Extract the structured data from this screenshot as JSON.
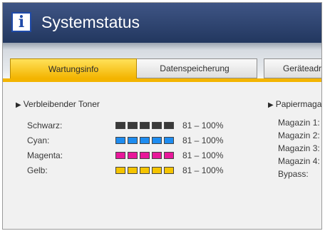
{
  "header": {
    "title": "Systemstatus",
    "icon": "info-icon"
  },
  "tabs": [
    {
      "label": "Wartungsinfo",
      "active": true
    },
    {
      "label": "Datenspeicherung",
      "active": false
    },
    {
      "label": "Geräteadr",
      "active": false
    }
  ],
  "toner": {
    "heading": "Verbleibender Toner",
    "rows": [
      {
        "label": "Schwarz:",
        "color": "#3a3a3a",
        "value": "81 – 100%"
      },
      {
        "label": "Cyan:",
        "color": "#1e8cf0",
        "value": "81 – 100%"
      },
      {
        "label": "Magenta:",
        "color": "#e8179a",
        "value": "81 – 100%"
      },
      {
        "label": "Gelb:",
        "color": "#f5c400",
        "value": "81 – 100%"
      }
    ]
  },
  "paper": {
    "heading": "Papiermaga",
    "items": [
      "Magazin 1:",
      "Magazin 2:",
      "Magazin 3:",
      "Magazin 4:",
      "Bypass:"
    ]
  }
}
